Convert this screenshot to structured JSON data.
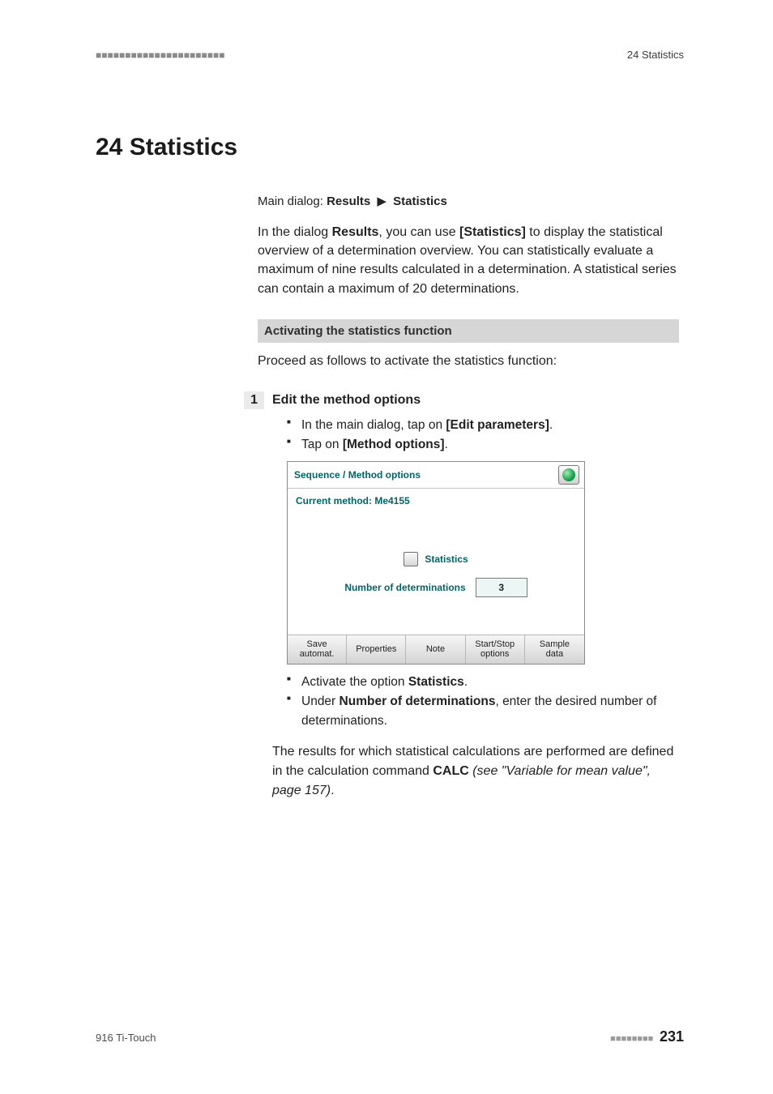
{
  "header": {
    "dashes": "■■■■■■■■■■■■■■■■■■■■■■",
    "right": "24 Statistics"
  },
  "chapter": {
    "title": "24 Statistics"
  },
  "breadcrumb": {
    "lead": "Main dialog: ",
    "b1": "Results",
    "arrow": "▶",
    "b2": "Statistics"
  },
  "intro": {
    "p1a": "In the dialog ",
    "p1b": "Results",
    "p1c": ", you can use ",
    "p1d": "[Statistics]",
    "p1e": " to display the statistical overview of a determination overview. You can statistically evaluate a maximum of nine results calculated in a determination. A statistical series can contain a maximum of 20 determinations."
  },
  "section": {
    "bar": "Activating the statistics function",
    "lead": "Proceed as follows to activate the statistics function:"
  },
  "step": {
    "num": "1",
    "title": "Edit the method options",
    "li1a": "In the main dialog, tap on ",
    "li1b": "[Edit parameters]",
    "li1c": ".",
    "li2a": "Tap on ",
    "li2b": "[Method options]",
    "li2c": "."
  },
  "dialog": {
    "title": "Sequence / Method options",
    "current": "Current method: Me4155",
    "stat_label": "Statistics",
    "num_label": "Number of determinations",
    "num_value": "3",
    "btn1": "Save\nautomat.",
    "btn2": "Properties",
    "btn3": "Note",
    "btn4": "Start/Stop\noptions",
    "btn5": "Sample\ndata"
  },
  "post": {
    "li1a": "Activate the option ",
    "li1b": "Statistics",
    "li1c": ".",
    "li2a": "Under ",
    "li2b": "Number of determinations",
    "li2c": ", enter the desired number of determinations."
  },
  "closing": {
    "a": "The results for which statistical calculations are performed are defined in the calculation command ",
    "b": "CALC",
    "c": " (see \"Variable for mean value\", page 157)",
    "d": "."
  },
  "footer": {
    "left": "916 Ti-Touch",
    "dashes": "■■■■■■■■",
    "page": "231"
  }
}
